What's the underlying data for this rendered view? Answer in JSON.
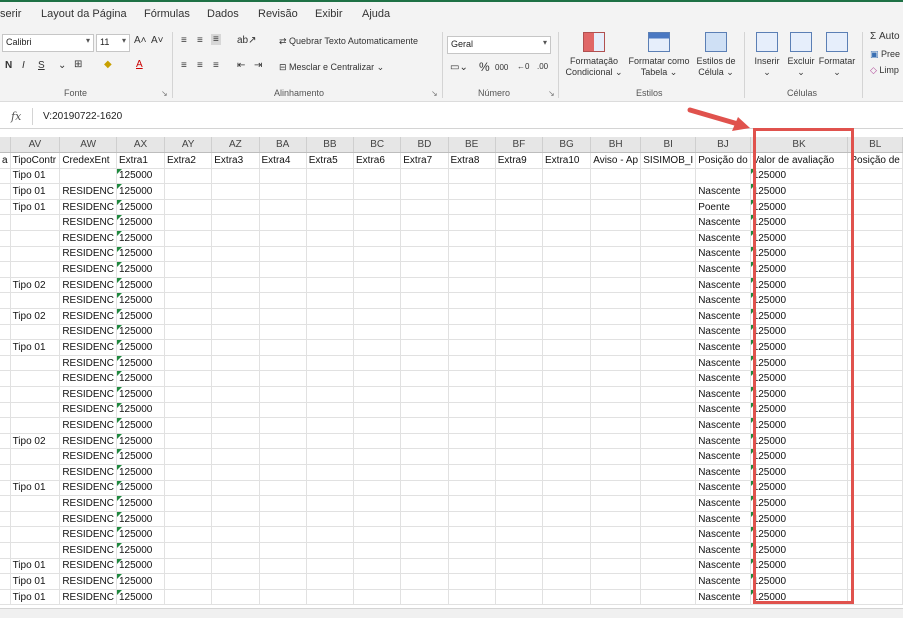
{
  "menu": {
    "items": [
      "serir",
      "Layout da Página",
      "Fórmulas",
      "Dados",
      "Revisão",
      "Exibir",
      "Ajuda"
    ]
  },
  "ribbon": {
    "font_name": "Calibri",
    "font_size": "11",
    "number_format": "Geral",
    "wrap_text": "Quebrar Texto Automaticamente",
    "merge_center": "Mesclar e Centralizar",
    "cond_format": [
      "Formatação",
      "Condicional"
    ],
    "format_table": [
      "Formatar como",
      "Tabela"
    ],
    "cell_styles": [
      "Estilos de",
      "Célula"
    ],
    "insert": "Inserir",
    "delete": "Excluir",
    "format": "Formatar",
    "autosum": "Auto",
    "fill": "Pree",
    "clear": "Limp",
    "bold": "N",
    "italic": "I",
    "underline": "S",
    "percent": "%",
    "thousands": "000",
    "groups": [
      "Fonte",
      "Alinhamento",
      "Número",
      "Estilos",
      "Células"
    ]
  },
  "formula_bar": {
    "fx": "fx",
    "value": "V:20190722-1620"
  },
  "sheet": {
    "columns": [
      "AV",
      "AW",
      "AX",
      "AY",
      "AZ",
      "BA",
      "BB",
      "BC",
      "BD",
      "BE",
      "BF",
      "BG",
      "BH",
      "BI",
      "BJ",
      "BK",
      "BL"
    ],
    "left_partial_header": "a",
    "headers": [
      "TipoContr",
      "CredexEnt",
      "Extra1",
      "Extra2",
      "Extra3",
      "Extra4",
      "Extra5",
      "Extra6",
      "Extra7",
      "Extra8",
      "Extra9",
      "Extra10",
      "Aviso - Ap",
      "SISIMOB_I",
      "Posição do",
      "Valor de avaliação",
      "Posição de"
    ],
    "rows": [
      [
        "Tipo 01",
        "",
        "125000",
        "",
        "",
        "",
        "",
        "",
        "",
        "",
        "",
        "",
        "",
        "",
        "",
        "125000",
        ""
      ],
      [
        "Tipo 01",
        "RESIDENC",
        "125000",
        "",
        "",
        "",
        "",
        "",
        "",
        "",
        "",
        "",
        "",
        "",
        "Nascente",
        "125000",
        ""
      ],
      [
        "Tipo 01",
        "RESIDENC",
        "125000",
        "",
        "",
        "",
        "",
        "",
        "",
        "",
        "",
        "",
        "",
        "",
        "Poente",
        "125000",
        ""
      ],
      [
        "",
        "RESIDENC",
        "125000",
        "",
        "",
        "",
        "",
        "",
        "",
        "",
        "",
        "",
        "",
        "",
        "Nascente",
        "125000",
        ""
      ],
      [
        "",
        "RESIDENC",
        "125000",
        "",
        "",
        "",
        "",
        "",
        "",
        "",
        "",
        "",
        "",
        "",
        "Nascente",
        "125000",
        ""
      ],
      [
        "",
        "RESIDENC",
        "125000",
        "",
        "",
        "",
        "",
        "",
        "",
        "",
        "",
        "",
        "",
        "",
        "Nascente",
        "125000",
        ""
      ],
      [
        "",
        "RESIDENC",
        "125000",
        "",
        "",
        "",
        "",
        "",
        "",
        "",
        "",
        "",
        "",
        "",
        "Nascente",
        "125000",
        ""
      ],
      [
        "Tipo 02",
        "RESIDENC",
        "125000",
        "",
        "",
        "",
        "",
        "",
        "",
        "",
        "",
        "",
        "",
        "",
        "Nascente",
        "125000",
        ""
      ],
      [
        "",
        "RESIDENC",
        "125000",
        "",
        "",
        "",
        "",
        "",
        "",
        "",
        "",
        "",
        "",
        "",
        "Nascente",
        "125000",
        ""
      ],
      [
        "Tipo 02",
        "RESIDENC",
        "125000",
        "",
        "",
        "",
        "",
        "",
        "",
        "",
        "",
        "",
        "",
        "",
        "Nascente",
        "125000",
        ""
      ],
      [
        "",
        "RESIDENC",
        "125000",
        "",
        "",
        "",
        "",
        "",
        "",
        "",
        "",
        "",
        "",
        "",
        "Nascente",
        "125000",
        ""
      ],
      [
        "Tipo 01",
        "RESIDENC",
        "125000",
        "",
        "",
        "",
        "",
        "",
        "",
        "",
        "",
        "",
        "",
        "",
        "Nascente",
        "125000",
        ""
      ],
      [
        "",
        "RESIDENC",
        "125000",
        "",
        "",
        "",
        "",
        "",
        "",
        "",
        "",
        "",
        "",
        "",
        "Nascente",
        "125000",
        ""
      ],
      [
        "",
        "RESIDENC",
        "125000",
        "",
        "",
        "",
        "",
        "",
        "",
        "",
        "",
        "",
        "",
        "",
        "Nascente",
        "125000",
        ""
      ],
      [
        "",
        "RESIDENC",
        "125000",
        "",
        "",
        "",
        "",
        "",
        "",
        "",
        "",
        "",
        "",
        "",
        "Nascente",
        "125000",
        ""
      ],
      [
        "",
        "RESIDENC",
        "125000",
        "",
        "",
        "",
        "",
        "",
        "",
        "",
        "",
        "",
        "",
        "",
        "Nascente",
        "125000",
        ""
      ],
      [
        "",
        "RESIDENC",
        "125000",
        "",
        "",
        "",
        "",
        "",
        "",
        "",
        "",
        "",
        "",
        "",
        "Nascente",
        "125000",
        ""
      ],
      [
        "Tipo 02",
        "RESIDENC",
        "125000",
        "",
        "",
        "",
        "",
        "",
        "",
        "",
        "",
        "",
        "",
        "",
        "Nascente",
        "125000",
        ""
      ],
      [
        "",
        "RESIDENC",
        "125000",
        "",
        "",
        "",
        "",
        "",
        "",
        "",
        "",
        "",
        "",
        "",
        "Nascente",
        "125000",
        ""
      ],
      [
        "",
        "RESIDENC",
        "125000",
        "",
        "",
        "",
        "",
        "",
        "",
        "",
        "",
        "",
        "",
        "",
        "Nascente",
        "125000",
        ""
      ],
      [
        "Tipo 01",
        "RESIDENC",
        "125000",
        "",
        "",
        "",
        "",
        "",
        "",
        "",
        "",
        "",
        "",
        "",
        "Nascente",
        "125000",
        ""
      ],
      [
        "",
        "RESIDENC",
        "125000",
        "",
        "",
        "",
        "",
        "",
        "",
        "",
        "",
        "",
        "",
        "",
        "Nascente",
        "125000",
        ""
      ],
      [
        "",
        "RESIDENC",
        "125000",
        "",
        "",
        "",
        "",
        "",
        "",
        "",
        "",
        "",
        "",
        "",
        "Nascente",
        "125000",
        ""
      ],
      [
        "",
        "RESIDENC",
        "125000",
        "",
        "",
        "",
        "",
        "",
        "",
        "",
        "",
        "",
        "",
        "",
        "Nascente",
        "125000",
        ""
      ],
      [
        "",
        "RESIDENC",
        "125000",
        "",
        "",
        "",
        "",
        "",
        "",
        "",
        "",
        "",
        "",
        "",
        "Nascente",
        "125000",
        ""
      ],
      [
        "Tipo 01",
        "RESIDENC",
        "125000",
        "",
        "",
        "",
        "",
        "",
        "",
        "",
        "",
        "",
        "",
        "",
        "Nascente",
        "125000",
        ""
      ],
      [
        "Tipo 01",
        "RESIDENC",
        "125000",
        "",
        "",
        "",
        "",
        "",
        "",
        "",
        "",
        "",
        "",
        "",
        "Nascente",
        "125000",
        ""
      ],
      [
        "Tipo 01",
        "RESIDENC",
        "125000",
        "",
        "",
        "",
        "",
        "",
        "",
        "",
        "",
        "",
        "",
        "",
        "Nascente",
        "125000",
        ""
      ]
    ]
  },
  "colors": {
    "highlight": "#e0524d",
    "excel_green": "#1e7145"
  }
}
